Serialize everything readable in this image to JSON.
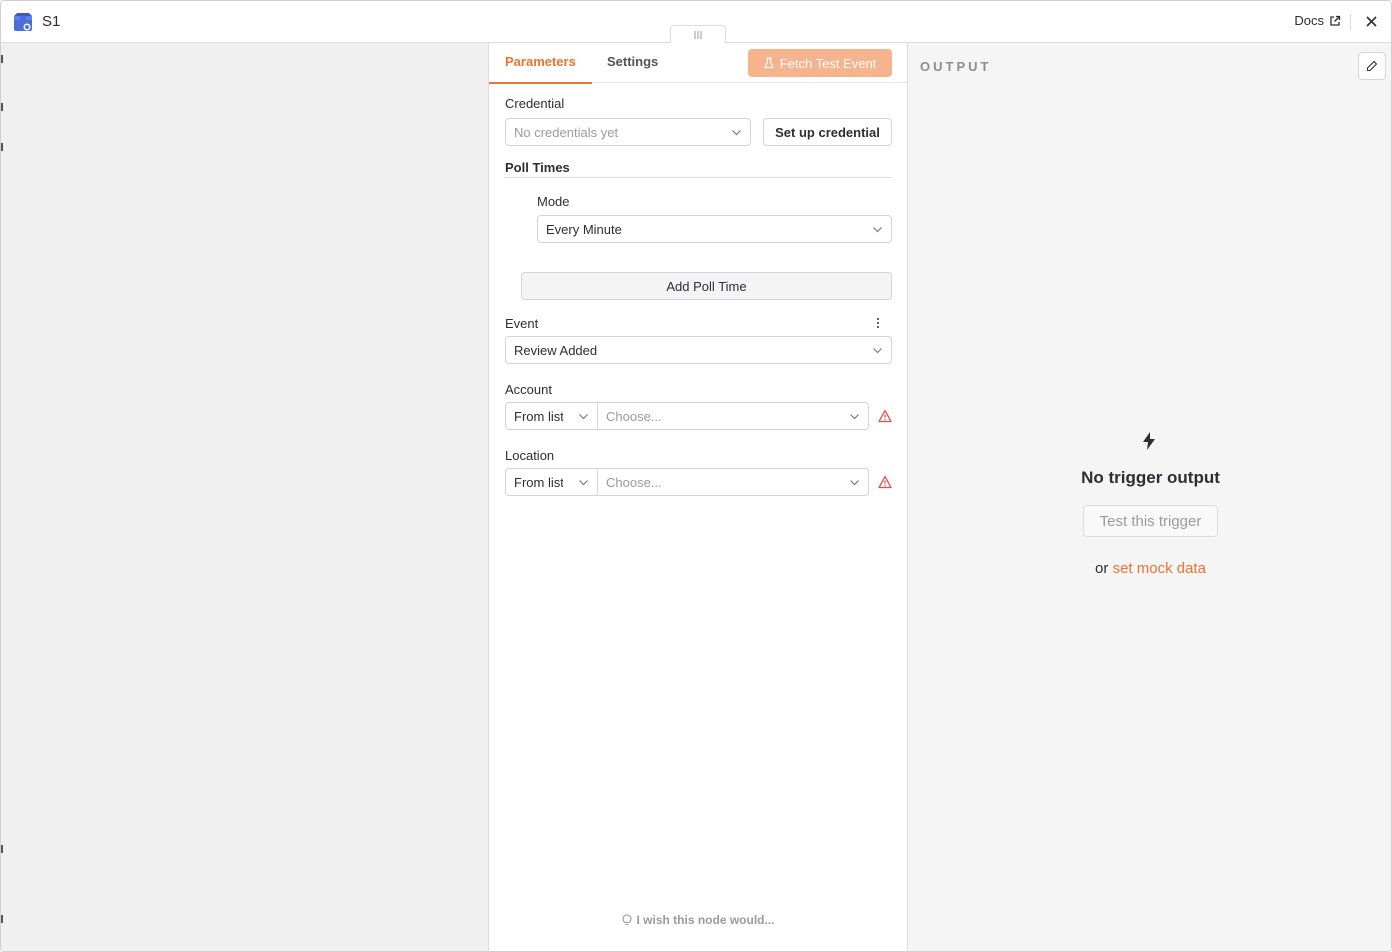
{
  "header": {
    "title": "S1",
    "docs_label": "Docs"
  },
  "tabs": [
    {
      "label": "Parameters",
      "active": true
    },
    {
      "label": "Settings",
      "active": false
    }
  ],
  "fetch_button_label": "Fetch Test Event",
  "credential": {
    "label": "Credential",
    "placeholder": "No credentials yet",
    "setup_button": "Set up credential"
  },
  "poll_times": {
    "label": "Poll Times",
    "mode_label": "Mode",
    "mode_value": "Every Minute",
    "add_button": "Add Poll Time"
  },
  "event": {
    "label": "Event",
    "value": "Review Added"
  },
  "account": {
    "label": "Account",
    "mode": "From list",
    "placeholder": "Choose..."
  },
  "location": {
    "label": "Location",
    "mode": "From list",
    "placeholder": "Choose..."
  },
  "feedback_link": "I wish this node would...",
  "output": {
    "title": "OUTPUT",
    "empty_title": "No trigger output",
    "test_button": "Test this trigger",
    "or_text": "or",
    "mock_link": "set mock data"
  },
  "colors": {
    "accent": "#ee7232",
    "accent_disabled": "#f5b48d",
    "warning": "#e5484d"
  },
  "icons": [
    "google-business-profile-icon",
    "external-link-icon",
    "close-icon",
    "drag-handle-icon",
    "flask-icon",
    "chevron-down-icon",
    "kebab-icon",
    "warning-icon",
    "lightbulb-icon",
    "pencil-icon",
    "bolt-icon"
  ]
}
